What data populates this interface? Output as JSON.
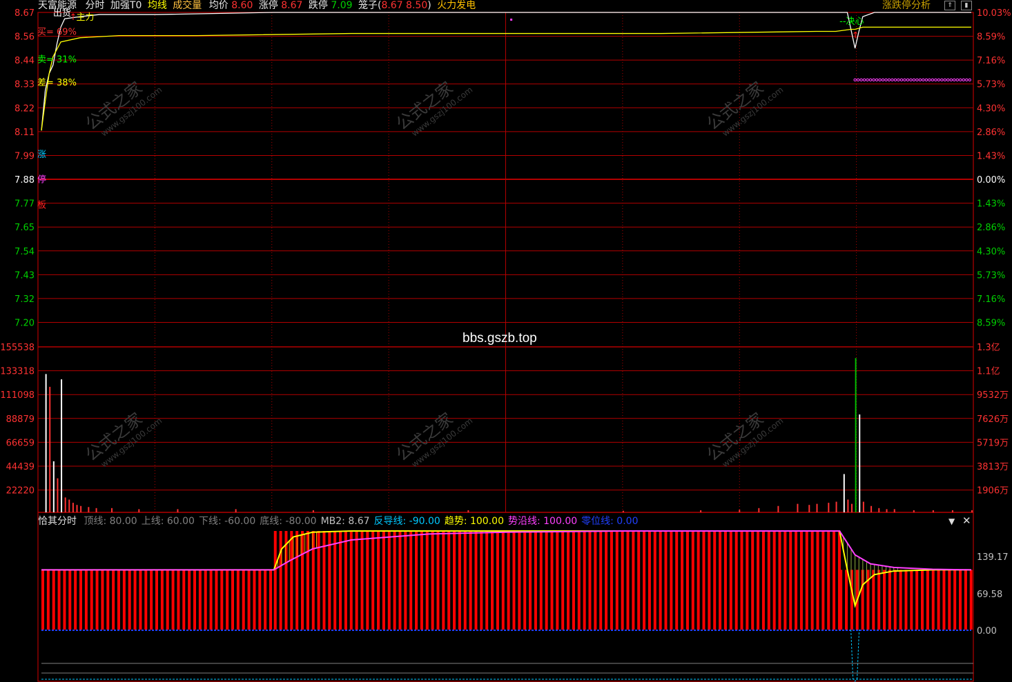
{
  "header": {
    "stock_name": "天富能源",
    "mode": "分时",
    "enhance": "加强T0",
    "avg_line_label": "均线",
    "volume_label": "成交量",
    "avg_price_label": "均价",
    "avg_price_value": "8.60",
    "limit_up_label": "涨停",
    "limit_up_value": "8.67",
    "limit_down_label": "跌停",
    "limit_down_value": "7.09",
    "cage_label": "笼子(",
    "cage_values": "8.67 8.50",
    "cage_close": ")",
    "sector": "火力发电",
    "analysis_link": "涨跌停分析"
  },
  "watermark_center": "bbs.gszb.top",
  "watermark_stamp": "公式之家 www.gszj100.com",
  "colors": {
    "grid": "#b40000",
    "price_up": "#ff3232",
    "price_down": "#00d000",
    "price_line": "#ffffff",
    "avg_line": "#ffff00",
    "vol_up": "#ff3232",
    "vol_up_hollow": "#ffffff",
    "vol_down": "#00c000",
    "bars": "#ff0000",
    "magenta": "#ff40ff",
    "cyan": "#00c8ff",
    "yellow": "#ffff00"
  },
  "chart_data": [
    {
      "type": "line",
      "title": "分时",
      "y_ticks_left": [
        "8.67",
        "8.56",
        "8.44",
        "8.33",
        "8.22",
        "8.11",
        "7.99",
        "7.88",
        "7.77",
        "7.65",
        "7.54",
        "7.43",
        "7.32",
        "7.20"
      ],
      "y_ticks_right": [
        "10.03%",
        "8.59%",
        "7.16%",
        "5.73%",
        "4.30%",
        "2.86%",
        "1.43%",
        "0.00%",
        "1.43%",
        "2.86%",
        "4.30%",
        "5.73%",
        "7.16%",
        "8.59%"
      ],
      "ylim": [
        7.2,
        8.67
      ],
      "prev_close": 7.88,
      "x_range": [
        0,
        240
      ],
      "series": [
        {
          "name": "价格",
          "x": [
            0,
            1,
            2,
            3,
            4,
            5,
            6,
            10,
            15,
            30,
            60,
            120,
            180,
            200,
            208,
            210,
            211,
            212,
            215,
            225,
            240
          ],
          "y": [
            8.11,
            8.3,
            8.38,
            8.42,
            8.52,
            8.6,
            8.64,
            8.65,
            8.66,
            8.66,
            8.67,
            8.67,
            8.67,
            8.67,
            8.67,
            8.5,
            8.58,
            8.65,
            8.67,
            8.67,
            8.67
          ]
        },
        {
          "name": "均线",
          "x": [
            0,
            1,
            2,
            3,
            5,
            10,
            20,
            40,
            80,
            120,
            160,
            200,
            205,
            209,
            210,
            212,
            215,
            225,
            240
          ],
          "y": [
            8.11,
            8.25,
            8.38,
            8.46,
            8.53,
            8.55,
            8.56,
            8.56,
            8.57,
            8.57,
            8.57,
            8.58,
            8.58,
            8.59,
            8.59,
            8.6,
            8.6,
            8.6,
            8.6
          ]
        }
      ],
      "annotations": [
        {
          "text": "出货",
          "x": 3,
          "y": 8.67,
          "color": "#ffffff"
        },
        {
          "text": "主力",
          "x": 9,
          "y": 8.65,
          "color": "#ffff00"
        },
        {
          "text": "买= 69%",
          "x": 0,
          "y": 8.58,
          "color": "#ff3232"
        },
        {
          "text": "卖= 31%",
          "x": 0,
          "y": 8.45,
          "color": "#00ff00"
        },
        {
          "text": "差= 38%",
          "x": 0,
          "y": 8.34,
          "color": "#ffff00"
        },
        {
          "text": "涨",
          "x": 0,
          "y": 8.0,
          "color": "#00c8ff"
        },
        {
          "text": "停",
          "x": 0,
          "y": 7.88,
          "color": "#ff40ff"
        },
        {
          "text": "板",
          "x": 0,
          "y": 7.76,
          "color": "#ff2020"
        },
        {
          "text": "--决心",
          "x": 206,
          "y": 8.63,
          "color": "#00ff00"
        }
      ],
      "dotted_level": {
        "y": 8.35,
        "x_start": 210,
        "x_end": 240,
        "color": "#ff40ff"
      }
    },
    {
      "type": "bar",
      "title": "成交量",
      "y_ticks_left": [
        "155538",
        "133318",
        "111098",
        "88879",
        "66659",
        "44439",
        "22220"
      ],
      "y_ticks_right": [
        "1.3亿",
        "1.1亿",
        "9532万",
        "7626万",
        "5719万",
        "3813万",
        "1906万"
      ],
      "ylim": [
        0,
        155538
      ],
      "x": [
        1,
        2,
        3,
        4,
        5,
        6,
        7,
        8,
        9,
        10,
        12,
        14,
        18,
        25,
        35,
        50,
        70,
        110,
        150,
        170,
        180,
        185,
        190,
        195,
        198,
        200,
        203,
        205,
        207,
        208,
        209,
        210,
        211,
        212,
        214,
        216,
        218,
        220,
        225,
        230,
        235,
        240
      ],
      "values": [
        130000,
        118000,
        48000,
        32000,
        125000,
        14000,
        12000,
        9000,
        7000,
        6000,
        5000,
        4000,
        4000,
        3000,
        3000,
        3000,
        2000,
        2000,
        1500,
        2000,
        2500,
        4000,
        6000,
        8000,
        7000,
        8000,
        9000,
        10000,
        36000,
        12000,
        8000,
        145000,
        92000,
        10000,
        6000,
        4000,
        3000,
        3000,
        2000,
        2000,
        2000,
        2000
      ],
      "colors": [
        "up",
        "up",
        "up",
        "up",
        "up",
        "up",
        "up",
        "up",
        "up",
        "up",
        "up",
        "up",
        "up",
        "up",
        "up",
        "up",
        "up",
        "up",
        "up",
        "up",
        "up",
        "up",
        "up",
        "up",
        "up",
        "up",
        "up",
        "up",
        "up",
        "up",
        "up",
        "down",
        "up",
        "up",
        "up",
        "up",
        "up",
        "up",
        "up",
        "up",
        "up",
        "up"
      ]
    },
    {
      "type": "bar",
      "title": "恰其分时",
      "legend": [
        {
          "label": "顶线:",
          "value": "80.00",
          "color": "#808080"
        },
        {
          "label": "上线:",
          "value": "60.00",
          "color": "#808080"
        },
        {
          "label": "下线:",
          "value": "-60.00",
          "color": "#808080"
        },
        {
          "label": "底线:",
          "value": "-80.00",
          "color": "#808080"
        },
        {
          "label": "MB2:",
          "value": "8.67",
          "color": "#c0c0c0"
        },
        {
          "label": "反导线:",
          "value": "-90.00",
          "color": "#00c8ff"
        },
        {
          "label": "趋势:",
          "value": "100.00",
          "color": "#ffff00"
        },
        {
          "label": "势沿线:",
          "value": "100.00",
          "color": "#ff40ff"
        },
        {
          "label": "零位线:",
          "value": "0.00",
          "color": "#2040ff"
        }
      ],
      "y_ticks_right": [
        "139.17",
        "69.58",
        "0.00"
      ],
      "ylim": [
        -80,
        165
      ],
      "bars": {
        "x_start": 0,
        "x_end": 240,
        "segments": [
          {
            "from": 0,
            "to": 60,
            "value": 100
          },
          {
            "from": 60,
            "to": 206,
            "value": 165
          },
          {
            "from": 206,
            "to": 240,
            "value": 100
          }
        ]
      },
      "trend_line": {
        "x": [
          0,
          60,
          62,
          65,
          70,
          80,
          100,
          120,
          206,
          208,
          210,
          212,
          215,
          220,
          230,
          240
        ],
        "y": [
          100,
          100,
          135,
          155,
          163,
          165,
          165,
          165,
          165,
          100,
          40,
          75,
          92,
          98,
          100,
          100
        ]
      },
      "edge_line": {
        "x": [
          0,
          60,
          64,
          70,
          80,
          100,
          120,
          150,
          206,
          208,
          210,
          214,
          220,
          230,
          240
        ],
        "y": [
          100,
          100,
          115,
          135,
          150,
          160,
          163,
          165,
          165,
          145,
          125,
          110,
          104,
          101,
          100
        ]
      },
      "zero_line": 0,
      "guide_spike": {
        "x": 210,
        "y_bottom": -90
      }
    }
  ]
}
